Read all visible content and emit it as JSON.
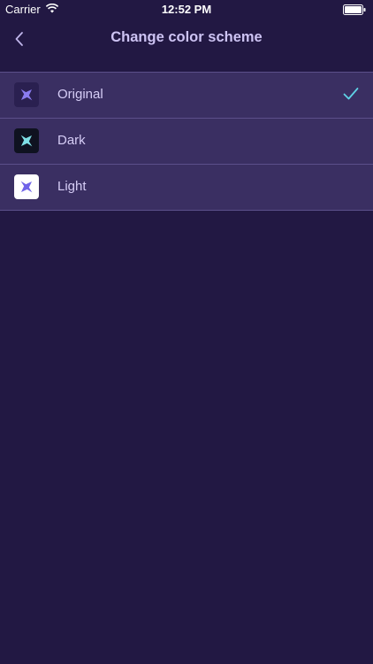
{
  "status_bar": {
    "carrier": "Carrier",
    "time": "12:52 PM"
  },
  "nav": {
    "title": "Change color scheme",
    "back_icon": "chevron-left-icon"
  },
  "schemes": [
    {
      "label": "Original",
      "selected": true,
      "icon": "airplane-icon",
      "icon_bg": "#2a2050",
      "icon_color": "#8a7cf0"
    },
    {
      "label": "Dark",
      "selected": false,
      "icon": "airplane-icon",
      "icon_bg": "#0f1220",
      "icon_color": "#7fe0e6"
    },
    {
      "label": "Light",
      "selected": false,
      "icon": "airplane-icon",
      "icon_bg": "#ffffff",
      "icon_color": "#6f63e8"
    }
  ],
  "colors": {
    "background": "#221843",
    "row": "#3a2f62",
    "accent": "#5fd2e6",
    "title": "#cdc3f3"
  }
}
